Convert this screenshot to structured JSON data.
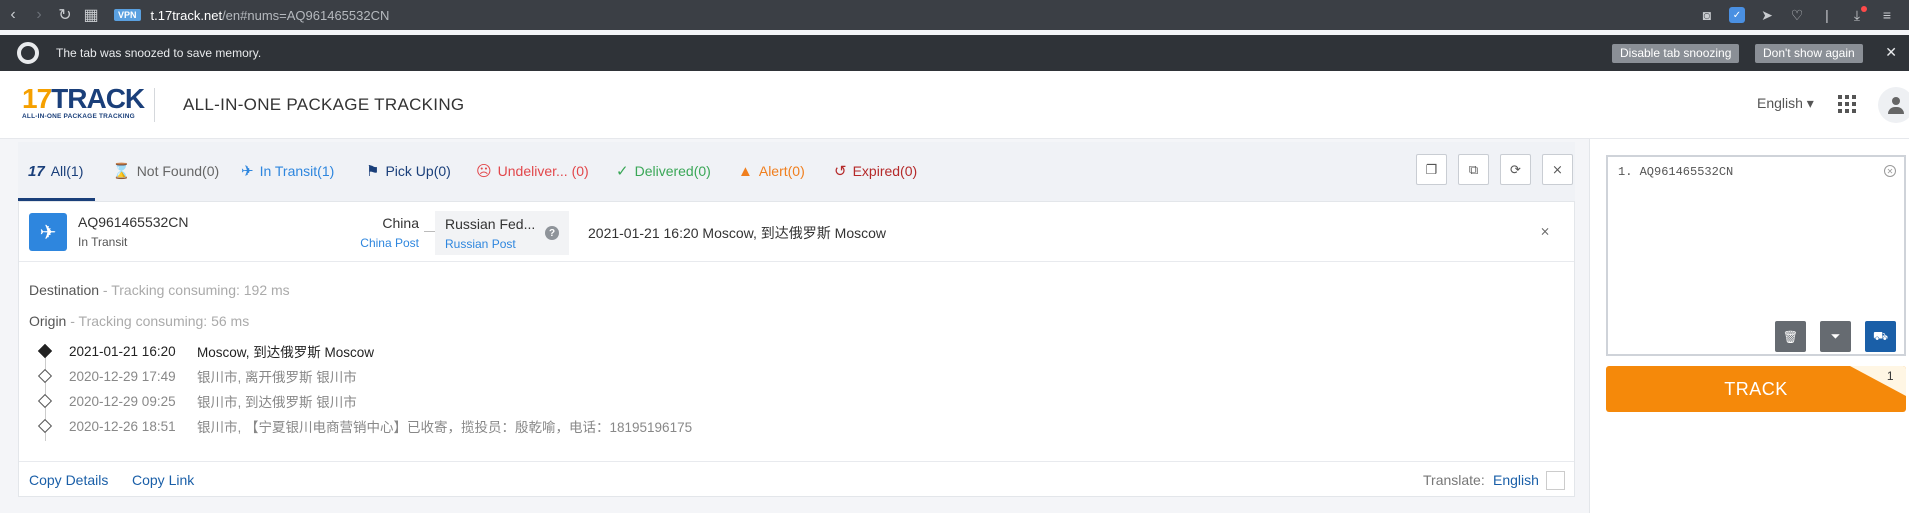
{
  "browser": {
    "url_host": "t.17track.net",
    "url_rest": "/en#nums=AQ961465532CN",
    "vpn": "VPN"
  },
  "snooze": {
    "message": "The tab was snoozed to save memory.",
    "disable_btn": "Disable tab snoozing",
    "dont_show_btn": "Don't show again"
  },
  "header": {
    "logo_main": "TRACK",
    "logo_num": "17",
    "logo_sub": "ALL-IN-ONE PACKAGE TRACKING",
    "title": "ALL-IN-ONE PACKAGE TRACKING",
    "language": "English"
  },
  "tabs": {
    "all": "All(1)",
    "not_found": "Not Found(0)",
    "in_transit": "In Transit(1)",
    "pick_up": "Pick Up(0)",
    "undelivered": "Undeliver... (0)",
    "delivered": "Delivered(0)",
    "alert": "Alert(0)",
    "expired": "Expired(0)"
  },
  "package": {
    "number": "AQ961465532CN",
    "status": "In Transit",
    "from_country": "China",
    "from_carrier": "China Post",
    "to_country": "Russian Fed...",
    "to_carrier": "Russian Post",
    "latest_event": "2021-01-21 16:20  Moscow, 到达俄罗斯 Moscow"
  },
  "meta": {
    "destination_label": "Destination",
    "destination_note": " - Tracking consuming: 192 ms",
    "origin_label": "Origin",
    "origin_note": " - Tracking consuming: 56 ms"
  },
  "events": [
    {
      "time": "2021-01-21 16:20",
      "desc": "Moscow, 到达俄罗斯 Moscow"
    },
    {
      "time": "2020-12-29 17:49",
      "desc": "银川市, 离开俄罗斯 银川市"
    },
    {
      "time": "2020-12-29 09:25",
      "desc": "银川市, 到达俄罗斯 银川市"
    },
    {
      "time": "2020-12-26 18:51",
      "desc": "银川市, 【宁夏银川电商营销中心】已收寄，揽投员：殷乾喻，电话：18195196175"
    }
  ],
  "footer": {
    "copy_details": "Copy Details",
    "copy_link": "Copy Link",
    "translate_label": "Translate:",
    "translate_value": "English"
  },
  "sidebar": {
    "input_value": "1. AQ961465532CN",
    "track_label": "TRACK",
    "track_count": "1"
  }
}
